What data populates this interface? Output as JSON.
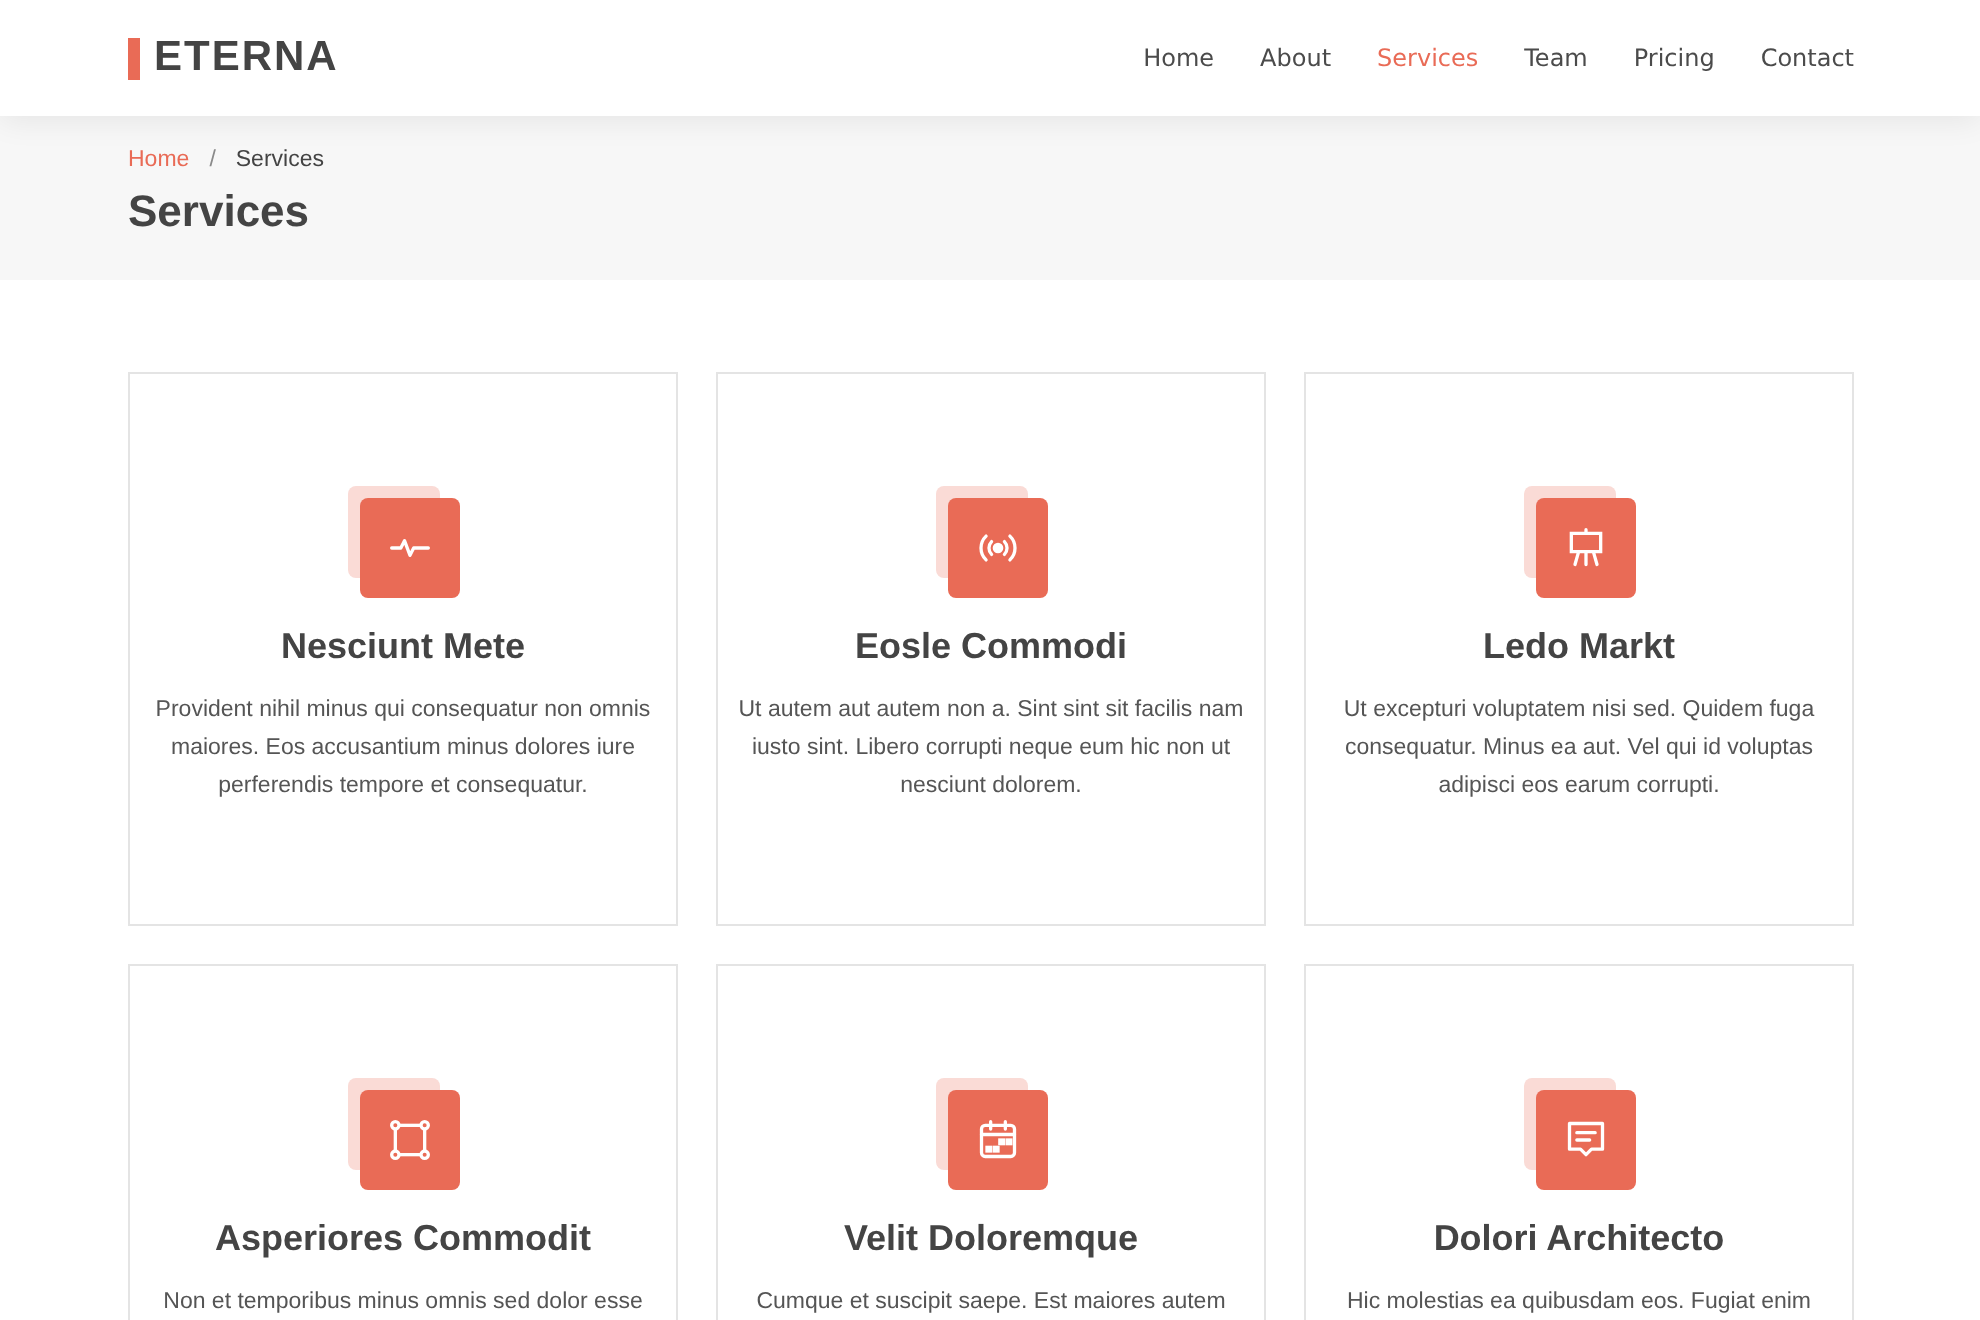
{
  "brand": {
    "name": "ETERNA"
  },
  "nav": [
    {
      "label": "Home",
      "selected": false
    },
    {
      "label": "About",
      "selected": false
    },
    {
      "label": "Services",
      "selected": true
    },
    {
      "label": "Team",
      "selected": false
    },
    {
      "label": "Pricing",
      "selected": false
    },
    {
      "label": "Contact",
      "selected": false
    }
  ],
  "breadcrumbs": [
    {
      "label": "Home",
      "link": true
    },
    {
      "label": "Services",
      "link": false
    }
  ],
  "breadcrumb_separator": "/",
  "page_title": "Services",
  "services": [
    {
      "kind": "pulse",
      "title": "Nesciunt Mete",
      "text": "Provident nihil minus qui consequatur non omnis maiores. Eos accusantium minus dolores iure perferendis tempore et consequatur."
    },
    {
      "kind": "broadcast",
      "title": "Eosle Commodi",
      "text": "Ut autem aut autem non a. Sint sint sit facilis nam iusto sint. Libero corrupti neque eum hic non ut nesciunt dolorem."
    },
    {
      "kind": "easel",
      "title": "Ledo Markt",
      "text": "Ut excepturi voluptatem nisi sed. Quidem fuga consequatur. Minus ea aut. Vel qui id voluptas adipisci eos earum corrupti."
    },
    {
      "kind": "bounding",
      "title": "Asperiores Commodit",
      "text": "Non et temporibus minus omnis sed dolor esse"
    },
    {
      "kind": "calendar",
      "title": "Velit Doloremque",
      "text": "Cumque et suscipit saepe. Est maiores autem"
    },
    {
      "kind": "chat",
      "title": "Dolori Architecto",
      "text": "Hic molestias ea quibusdam eos. Fugiat enim"
    }
  ]
}
